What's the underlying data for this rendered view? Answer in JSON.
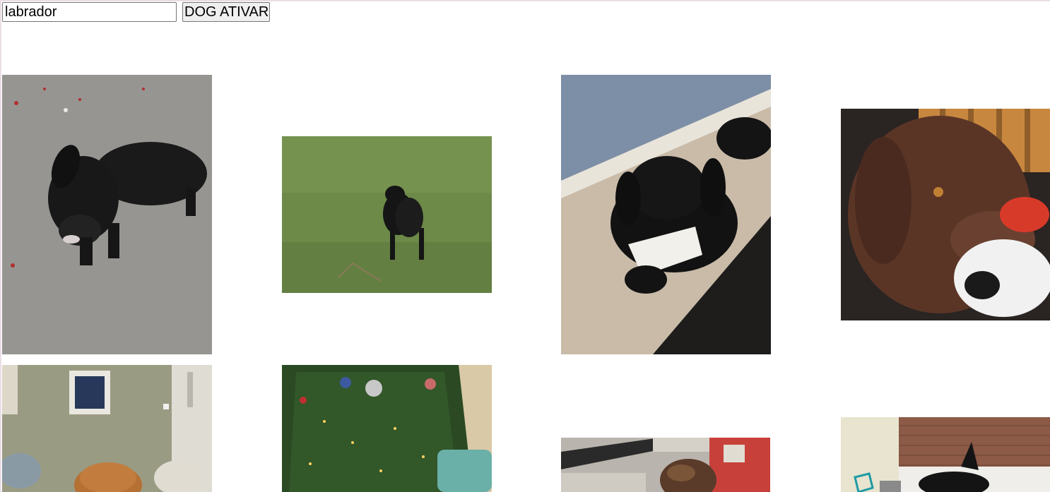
{
  "search": {
    "value": "labrador"
  },
  "action_button": {
    "label": "DOG ATIVAR"
  },
  "photos": [
    {
      "name": "black-labrador-on-pavement",
      "description_icon": "dog-photo"
    },
    {
      "name": "black-labrador-on-grass",
      "description_icon": "dog-photo"
    },
    {
      "name": "black-puppy-under-bed",
      "description_icon": "dog-photo"
    },
    {
      "name": "chocolate-labrador-with-toy",
      "description_icon": "dog-photo"
    },
    {
      "name": "dog-in-living-room",
      "description_icon": "dog-photo"
    },
    {
      "name": "christmas-tree-photo",
      "description_icon": "dog-photo"
    },
    {
      "name": "dog-in-car-photo",
      "description_icon": "dog-photo"
    },
    {
      "name": "dog-by-brick-wall",
      "description_icon": "dog-photo"
    }
  ],
  "colors": {
    "button_bg": "#efefef",
    "border": "#767676"
  }
}
